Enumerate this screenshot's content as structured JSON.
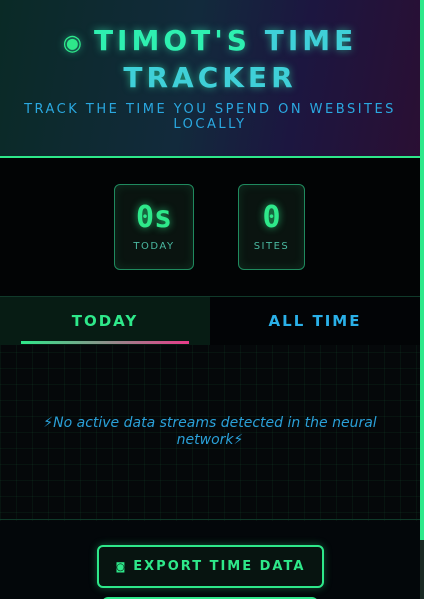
{
  "header": {
    "title_line1_dot": "◉",
    "title_line1_a": "TIMOT'S",
    "title_line1_b": "TIME",
    "title_line2": "TRACKER",
    "subtitle": "TRACK THE TIME YOU SPEND ON WEBSITES LOCALLY"
  },
  "stats": {
    "today_value": "0s",
    "today_label": "TODAY",
    "sites_value": "0",
    "sites_label": "SITES"
  },
  "tabs": {
    "today": "TODAY",
    "all_time": "ALL TIME",
    "active": "today"
  },
  "content": {
    "empty_message": "⚡No active data streams detected in the neural network⚡"
  },
  "footer": {
    "export_icon": "◙",
    "export_label": "EXPORT TIME DATA"
  },
  "colors": {
    "accent": "#2ee88a",
    "secondary": "#2aa8e0",
    "pink": "#e83a8a"
  }
}
